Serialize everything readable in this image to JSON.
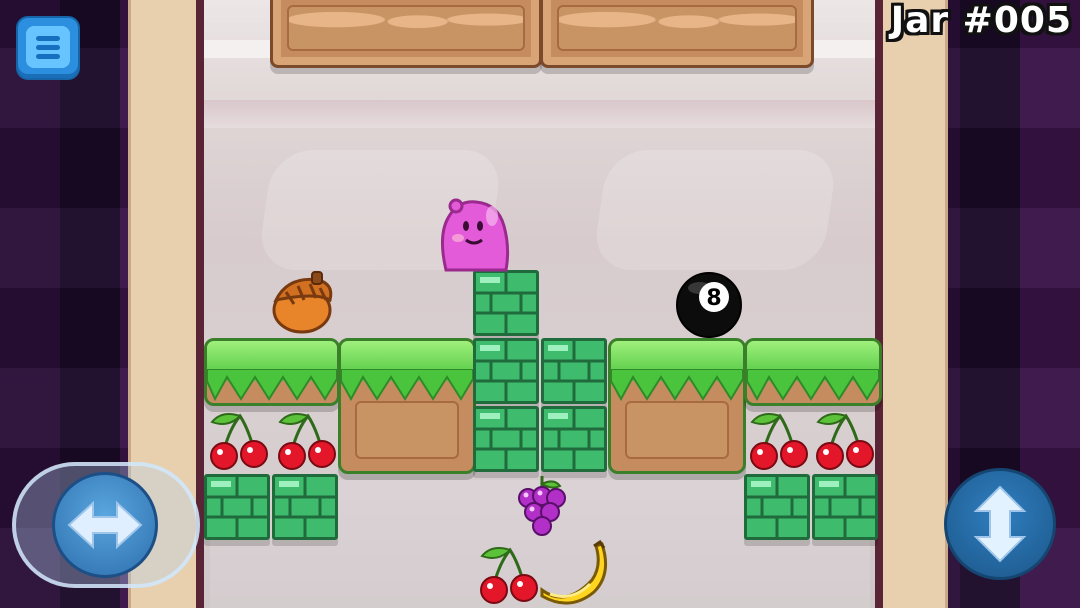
{
  "hud": {
    "jar_label": "Jar #005",
    "menu_icon": "hamburger-menu-icon"
  },
  "controls": {
    "horizontal_icon": "left-right-arrows-icon",
    "vertical_icon": "up-down-arrows-icon"
  },
  "level": {
    "player": "pink-blob",
    "items": [
      "acorn",
      "eight-ball",
      "cherries",
      "cherries",
      "cherries",
      "cherries",
      "grapes",
      "banana"
    ],
    "eight_ball_number": "8"
  },
  "colors": {
    "accent_blue": "#2b8ede",
    "brick_green": "#3fbb6e",
    "grass_green": "#4bc43d",
    "player_pink": "#e35bd9"
  }
}
